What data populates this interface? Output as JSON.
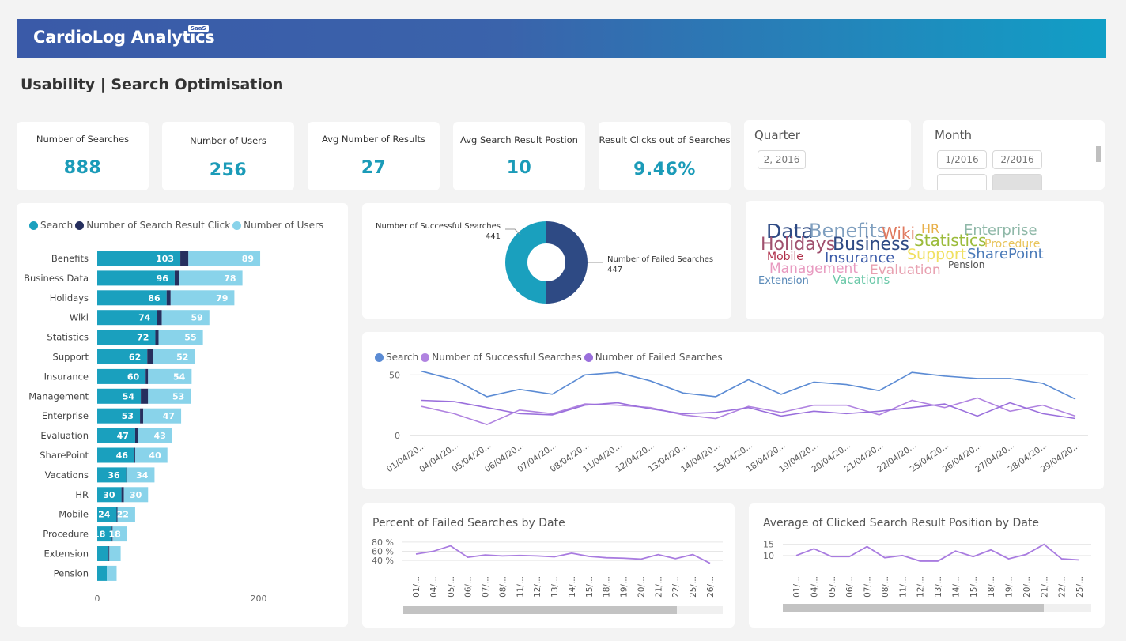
{
  "header": {
    "brand": "CardioLog Analytics",
    "badge": "SaaS"
  },
  "page_title": "Usability | Search Optimisation",
  "kpis": [
    {
      "label": "Number of Searches",
      "value": "888"
    },
    {
      "label": "Number of Users",
      "value": "256"
    },
    {
      "label": "Avg Number of Results",
      "value": "27"
    },
    {
      "label": "Avg Search Result Postion",
      "value": "10"
    },
    {
      "label": "Result Clicks out of Searches",
      "value": "9.46%"
    }
  ],
  "quarter_slicer": {
    "title": "Quarter",
    "options": [
      "2, 2016"
    ]
  },
  "month_slicer": {
    "title": "Month",
    "options": [
      "1/2016",
      "2/2016"
    ]
  },
  "colors": {
    "search": "#1aa0be",
    "clicks": "#262f5e",
    "users": "#89d3ea",
    "donut_success": "#1aa0be",
    "donut_failed": "#2e4a84",
    "line_search": "#5b8bd4",
    "line_success": "#b083e0",
    "line_failed": "#9a6fdc",
    "kpi_value": "#1b9bb8"
  },
  "bar_chart": {
    "legend": [
      "Search",
      "Number of Search Result Click",
      "Number of Users"
    ],
    "categories": [
      "Benefits",
      "Business Data",
      "Holidays",
      "Wiki",
      "Statistics",
      "Support",
      "Insurance",
      "Management",
      "Enterprise",
      "Evaluation",
      "SharePoint",
      "Vacations",
      "HR",
      "Mobile",
      "Procedure",
      "Extension",
      "Pension"
    ],
    "axis_ticks": [
      "0",
      "200"
    ]
  },
  "donut": {
    "success_label": "Number of Successful Searches",
    "success_value": "441",
    "failed_label": "Number of Failed Searches",
    "failed_value": "447"
  },
  "word_cloud": [
    {
      "text": "Data",
      "color": "#2e4a84"
    },
    {
      "text": "Benefits",
      "color": "#7f9fbf"
    },
    {
      "text": "Wiki",
      "color": "#e07a5f"
    },
    {
      "text": "HR",
      "color": "#e8b04a"
    },
    {
      "text": "Enterprise",
      "color": "#8fb8a8"
    },
    {
      "text": "Holidays",
      "color": "#a0506e"
    },
    {
      "text": "Business",
      "color": "#2e4a84"
    },
    {
      "text": "Statistics",
      "color": "#9bbb3a"
    },
    {
      "text": "Procedure",
      "color": "#e8c45a"
    },
    {
      "text": "Mobile",
      "color": "#b0304a"
    },
    {
      "text": "Insurance",
      "color": "#3a5aa8"
    },
    {
      "text": "Support",
      "color": "#f0e060"
    },
    {
      "text": "SharePoint",
      "color": "#4a7ab8"
    },
    {
      "text": "Management",
      "color": "#e89ac0"
    },
    {
      "text": "Evaluation",
      "color": "#e8a0b0"
    },
    {
      "text": "Pension",
      "color": "#555555"
    },
    {
      "text": "Extension",
      "color": "#5a8ab8"
    },
    {
      "text": "Vacations",
      "color": "#6ac8a8"
    }
  ],
  "line_chart": {
    "legend": [
      "Search",
      "Number of Successful Searches",
      "Number of Failed Searches"
    ],
    "y_ticks": [
      "50",
      "0"
    ],
    "x_labels": [
      "01/04/20...",
      "04/04/20...",
      "05/04/20...",
      "06/04/20...",
      "07/04/20...",
      "08/04/20...",
      "11/04/20...",
      "12/04/20...",
      "13/04/20...",
      "14/04/20...",
      "15/04/20...",
      "18/04/20...",
      "19/04/20...",
      "20/04/20...",
      "21/04/20...",
      "22/04/20...",
      "25/04/20...",
      "26/04/20...",
      "27/04/20...",
      "28/04/20...",
      "29/04/20..."
    ]
  },
  "failed_pct_chart": {
    "title": "Percent of Failed Searches by Date",
    "y_ticks": [
      "80 %",
      "60 %",
      "40 %"
    ],
    "x_labels": [
      "01/...",
      "04/...",
      "05/...",
      "06/...",
      "07/...",
      "08/...",
      "11/...",
      "12/...",
      "13/...",
      "14/...",
      "15/...",
      "18/...",
      "19/...",
      "20/...",
      "21/...",
      "22/...",
      "25/...",
      "26/..."
    ]
  },
  "avg_pos_chart": {
    "title": "Average of Clicked Search Result Position by Date",
    "y_ticks": [
      "15",
      "10"
    ],
    "x_labels": [
      "01/...",
      "04/...",
      "05/...",
      "06/...",
      "07/...",
      "08/...",
      "11/...",
      "12/...",
      "13/...",
      "14/...",
      "15/...",
      "18/...",
      "19/...",
      "20/...",
      "21/...",
      "22/...",
      "25/..."
    ]
  },
  "chart_data": [
    {
      "type": "bar",
      "stacked": true,
      "orientation": "horizontal",
      "categories": [
        "Benefits",
        "Business Data",
        "Holidays",
        "Wiki",
        "Statistics",
        "Support",
        "Insurance",
        "Management",
        "Enterprise",
        "Evaluation",
        "SharePoint",
        "Vacations",
        "HR",
        "Mobile",
        "Procedure",
        "Extension",
        "Pension"
      ],
      "series": [
        {
          "name": "Search",
          "values": [
            103,
            96,
            86,
            74,
            72,
            62,
            60,
            54,
            53,
            47,
            46,
            36,
            30,
            24,
            18,
            14,
            12
          ],
          "labels": [
            "103",
            "96",
            "86",
            "74",
            "72",
            "62",
            "60",
            "54",
            "53",
            "47",
            "46",
            "36",
            "30",
            "24",
            "18",
            "",
            ""
          ]
        },
        {
          "name": "Number of Search Result Click",
          "values": [
            10,
            6,
            5,
            6,
            4,
            7,
            3,
            9,
            4,
            3,
            1,
            1,
            3,
            1,
            1,
            1,
            0
          ],
          "labels": []
        },
        {
          "name": "Number of Users",
          "values": [
            89,
            78,
            79,
            59,
            55,
            52,
            54,
            53,
            47,
            43,
            40,
            34,
            30,
            22,
            18,
            14,
            12
          ],
          "labels": [
            "89",
            "78",
            "79",
            "59",
            "55",
            "52",
            "54",
            "53",
            "47",
            "43",
            "40",
            "34",
            "30",
            "22",
            "18",
            "",
            ""
          ]
        }
      ],
      "xlim": [
        0,
        200
      ],
      "legend_position": "top-left"
    },
    {
      "type": "pie",
      "donut": true,
      "slices": [
        {
          "name": "Number of Successful Searches",
          "value": 441
        },
        {
          "name": "Number of Failed Searches",
          "value": 447
        }
      ]
    },
    {
      "type": "line",
      "x": [
        "01/04/20...",
        "04/04/20...",
        "05/04/20...",
        "06/04/20...",
        "07/04/20...",
        "08/04/20...",
        "11/04/20...",
        "12/04/20...",
        "13/04/20...",
        "14/04/20...",
        "15/04/20...",
        "18/04/20...",
        "19/04/20...",
        "20/04/20...",
        "21/04/20...",
        "22/04/20...",
        "25/04/20...",
        "26/04/20...",
        "27/04/20...",
        "28/04/20...",
        "29/04/20..."
      ],
      "series": [
        {
          "name": "Search",
          "values": [
            53,
            46,
            32,
            38,
            34,
            50,
            52,
            45,
            35,
            32,
            46,
            34,
            44,
            42,
            37,
            52,
            49,
            47,
            47,
            43,
            30
          ]
        },
        {
          "name": "Number of Successful Searches",
          "values": [
            24,
            18,
            9,
            21,
            18,
            26,
            25,
            23,
            17,
            14,
            24,
            19,
            25,
            25,
            17,
            29,
            23,
            31,
            20,
            25,
            16
          ]
        },
        {
          "name": "Number of Failed Searches",
          "values": [
            29,
            28,
            23,
            18,
            17,
            25,
            27,
            22,
            18,
            19,
            23,
            16,
            20,
            18,
            20,
            23,
            26,
            16,
            27,
            18,
            14
          ]
        }
      ],
      "ylim": [
        0,
        58
      ],
      "legend_position": "top-left"
    },
    {
      "type": "line",
      "x": [
        "01/...",
        "04/...",
        "05/...",
        "06/...",
        "07/...",
        "08/...",
        "11/...",
        "12/...",
        "13/...",
        "14/...",
        "15/...",
        "18/...",
        "19/...",
        "20/...",
        "21/...",
        "22/...",
        "25/...",
        "26/..."
      ],
      "series": [
        {
          "name": "",
          "values": [
            54,
            60,
            72,
            47,
            52,
            50,
            51,
            50,
            48,
            56,
            49,
            46,
            45,
            43,
            53,
            44,
            53,
            34
          ]
        }
      ],
      "ylim": [
        30,
        85
      ]
    },
    {
      "type": "line",
      "x": [
        "01/...",
        "04/...",
        "05/...",
        "06/...",
        "07/...",
        "08/...",
        "11/...",
        "12/...",
        "13/...",
        "14/...",
        "15/...",
        "18/...",
        "19/...",
        "20/...",
        "21/...",
        "22/...",
        "25/..."
      ],
      "series": [
        {
          "name": "",
          "values": [
            10,
            13,
            9.5,
            9.5,
            14,
            9,
            10,
            7.5,
            7.5,
            12,
            9.5,
            12.5,
            8.5,
            10.5,
            15,
            8.5,
            8
          ]
        }
      ],
      "ylim": [
        5,
        17
      ]
    }
  ]
}
